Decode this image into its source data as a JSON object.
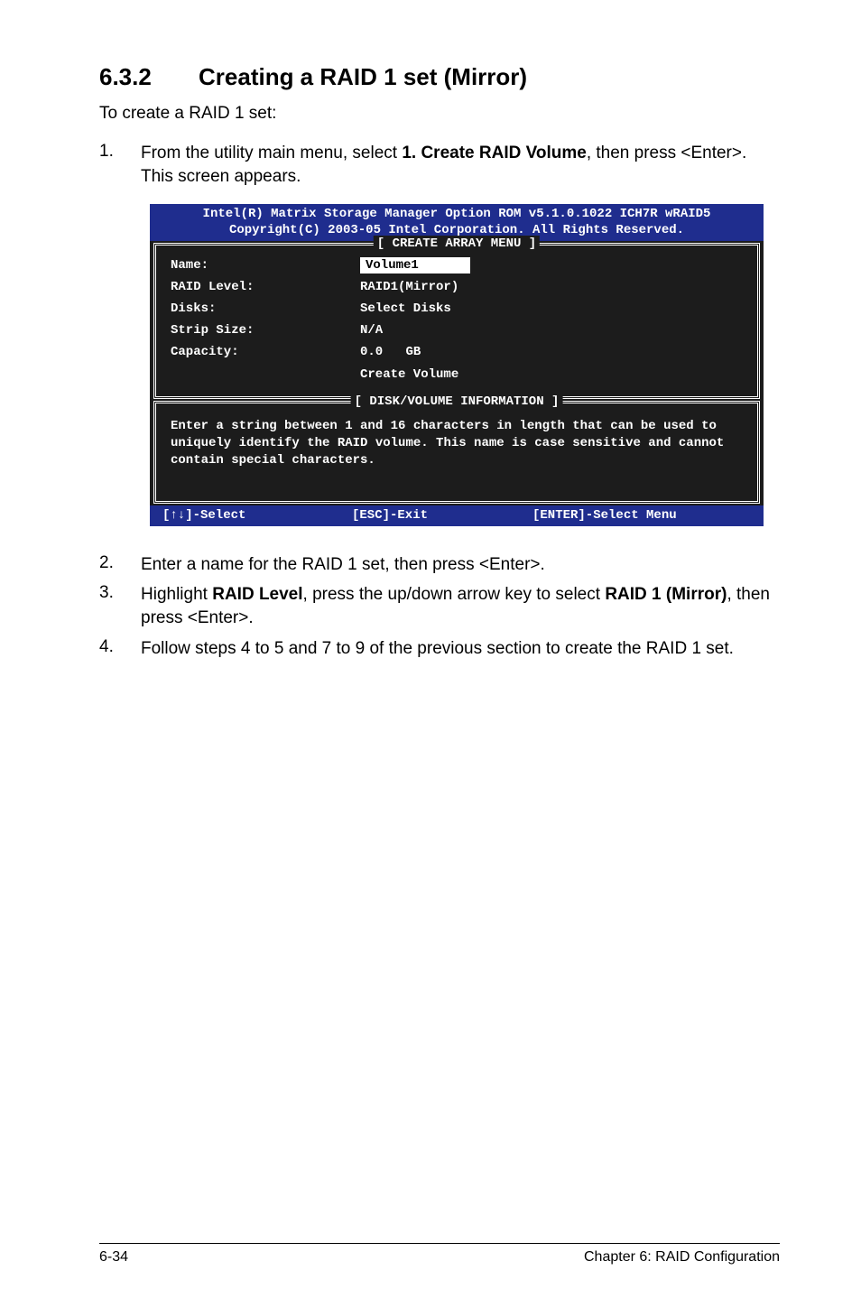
{
  "section": {
    "number": "6.3.2",
    "title": "Creating a RAID 1 set (Mirror)"
  },
  "intro": "To create a RAID 1 set:",
  "step1": {
    "num": "1.",
    "pre": "From the utility main menu, select ",
    "bold": "1. Create RAID Volume",
    "post": ", then press <Enter>. This screen appears."
  },
  "bios": {
    "header_line1": "Intel(R) Matrix Storage Manager Option ROM v5.1.0.1022 ICH7R wRAID5",
    "header_line2": "Copyright(C) 2003-05 Intel Corporation. All Rights Reserved.",
    "create_menu_label": "[ CREATE ARRAY MENU ]",
    "fields": {
      "name_label": "Name:",
      "name_value": "Volume1",
      "raid_level_label": "RAID Level:",
      "raid_level_value": "RAID1(Mirror)",
      "disks_label": "Disks:",
      "disks_value": "Select Disks",
      "strip_label": "Strip Size:",
      "strip_value": "N/A",
      "capacity_label": "Capacity:",
      "capacity_value": "0.0",
      "capacity_unit": "GB",
      "create_volume": "Create Volume"
    },
    "info_label": "[ DISK/VOLUME INFORMATION ]",
    "info_text": "Enter a string between 1 and 16 characters in length that can be used to uniquely identify the RAID volume. This name is case sensitive and cannot contain special characters.",
    "footbar": {
      "select": "[↑↓]-Select",
      "esc": "[ESC]-Exit",
      "enter": "[ENTER]-Select Menu"
    }
  },
  "step2": {
    "num": "2.",
    "text": "Enter a name for the RAID 1 set, then press <Enter>."
  },
  "step3": {
    "num": "3.",
    "pre": "Highlight ",
    "bold1": "RAID Level",
    "mid": ", press the up/down arrow key to select ",
    "bold2": "RAID 1 (Mirror)",
    "post": ", then press <Enter>."
  },
  "step4": {
    "num": "4.",
    "text": "Follow steps 4 to 5 and 7 to 9 of the previous section to create the RAID 1 set."
  },
  "footer": {
    "left": "6-34",
    "right": "Chapter 6: RAID Configuration"
  }
}
